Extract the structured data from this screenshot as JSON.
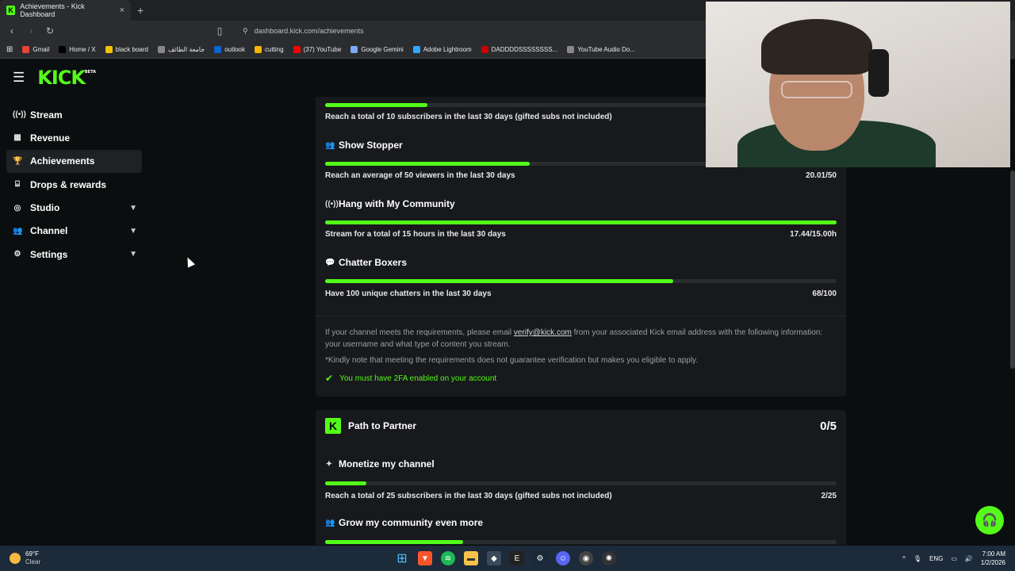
{
  "browser": {
    "tab_title": "Achievements - Kick Dashboard",
    "tab_close": "×",
    "new_tab": "+",
    "url": "dashboard.kick.com/achievements",
    "bookmarks": [
      {
        "label": "Gmail",
        "color": "#ea4335"
      },
      {
        "label": "Home / X",
        "color": "#000000"
      },
      {
        "label": "black board",
        "color": "#f2c200"
      },
      {
        "label": "جامعة الطائف",
        "color": "#888888"
      },
      {
        "label": "outlook",
        "color": "#0a64d6"
      },
      {
        "label": "cutting",
        "color": "#f4b400"
      },
      {
        "label": "(37) YouTube",
        "color": "#ff0000"
      },
      {
        "label": "Google Gemini",
        "color": "#7baaf7"
      },
      {
        "label": "Adobe Lightroom",
        "color": "#31a8ff"
      },
      {
        "label": "DADDDDSSSSSSSS...",
        "color": "#cc0000"
      },
      {
        "label": "YouTube Audio Do...",
        "color": "#888888"
      }
    ]
  },
  "app": {
    "logo": "KICK",
    "logo_badge": "BETA",
    "accent": "#53fc18"
  },
  "sidebar": {
    "items": [
      {
        "label": "Stream",
        "icon": "stream-icon",
        "glyph": "((•))"
      },
      {
        "label": "Revenue",
        "icon": "revenue-icon",
        "glyph": "▦"
      },
      {
        "label": "Achievements",
        "icon": "trophy-icon",
        "glyph": "🏆"
      },
      {
        "label": "Drops & rewards",
        "icon": "gift-icon",
        "glyph": "⌸"
      },
      {
        "label": "Studio",
        "icon": "studio-icon",
        "glyph": "◎"
      },
      {
        "label": "Channel",
        "icon": "channel-icon",
        "glyph": "👥"
      },
      {
        "label": "Settings",
        "icon": "settings-icon",
        "glyph": "⚙"
      }
    ]
  },
  "verification": {
    "first_req": {
      "text": "Reach a total of 10 subscribers in the last 30 days (gifted subs not included)",
      "progress": 0.2
    },
    "achievements": [
      {
        "title": "Show Stopper",
        "icon": "users-icon",
        "text": "Reach an average of 50 viewers in the last 30 days",
        "value": "20.01/50",
        "progress": 0.4
      },
      {
        "title": "Hang with My Community",
        "icon": "broadcast-icon",
        "text": "Stream for a total of 15 hours in the last 30 days",
        "value": "17.44/15.00h",
        "progress": 1.0
      },
      {
        "title": "Chatter Boxers",
        "icon": "chat-icon",
        "text": "Have 100 unique chatters in the last 30 days",
        "value": "68/100",
        "progress": 0.68
      }
    ],
    "note_before": "If your channel meets the requirements, please email ",
    "note_email": "verify@kick.com",
    "note_after": " from your associated Kick email address with the following information: your username and what type of content you stream.",
    "disclaimer": "*Kindly note that meeting the requirements does not guarantee verification but makes you eligible to apply.",
    "twofa": "You must have 2FA enabled on your account"
  },
  "partner": {
    "title": "Path to Partner",
    "count": "0/5",
    "achievements": [
      {
        "title": "Monetize my channel",
        "icon": "sparkle-icon",
        "text": "Reach a total of 25 subscribers in the last 30 days (gifted subs not included)",
        "value": "2/25",
        "progress": 0.08
      },
      {
        "title": "Grow my community even more",
        "icon": "users-icon",
        "progress": 0.27
      }
    ]
  },
  "taskbar": {
    "temp": "69°F",
    "weather": "Clear",
    "lang": "ENG",
    "time": "7:00 AM",
    "date": "1/2/2026"
  }
}
